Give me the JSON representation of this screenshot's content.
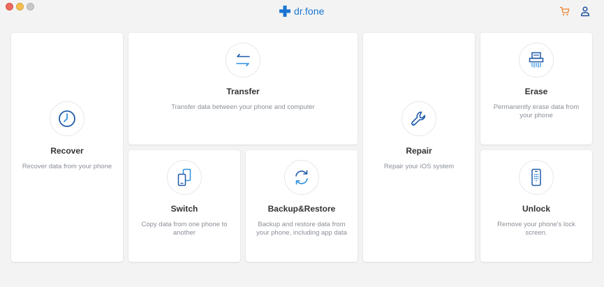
{
  "app": {
    "name": "dr.fone",
    "brand_color": "#1a75d2",
    "accent_cart_color": "#f0802c"
  },
  "header": {
    "icons": [
      "cart-icon",
      "user-icon"
    ]
  },
  "cards": {
    "recover": {
      "title": "Recover",
      "desc": "Recover data from your phone",
      "icon": "clock-icon"
    },
    "transfer": {
      "title": "Transfer",
      "desc": "Transfer data between your phone and computer",
      "icon": "transfer-arrows-icon"
    },
    "repair": {
      "title": "Repair",
      "desc": "Repair your iOS system",
      "icon": "wrench-icon"
    },
    "erase": {
      "title": "Erase",
      "desc": "Permanently erase data from your phone",
      "icon": "shredder-icon"
    },
    "switch": {
      "title": "Switch",
      "desc": "Copy data from one phone to another",
      "icon": "phones-switch-icon"
    },
    "backup": {
      "title": "Backup&Restore",
      "desc": "Backup and restore data from your phone, including app data",
      "icon": "sync-arrows-icon"
    },
    "unlock": {
      "title": "Unlock",
      "desc": "Remove your phone's lock screen.",
      "icon": "phone-keypad-icon"
    }
  }
}
